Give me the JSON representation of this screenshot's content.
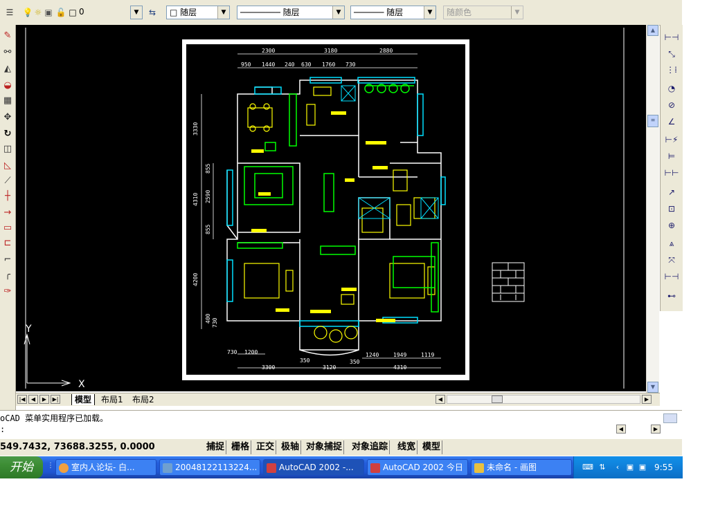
{
  "properties_toolbar": {
    "layer_value": "0",
    "color_value": "随层",
    "linetype_value": "随层",
    "lineweight_value": "随层",
    "plotstyle_value": "随颜色"
  },
  "tabs": {
    "model": "模型",
    "layout1": "布局1",
    "layout2": "布局2"
  },
  "axis": {
    "y": "Y",
    "x": "X"
  },
  "dimensions": {
    "top_row1": [
      "2300",
      "3180",
      "2880"
    ],
    "top_row2": [
      "950",
      "1440",
      "240",
      "630",
      "1760",
      "730"
    ],
    "left": [
      "3330",
      "855",
      "2590",
      "855",
      "4310",
      "4200",
      "400",
      "730"
    ],
    "bottom_row1": [
      "730",
      "1200",
      "350",
      "350",
      "1240",
      "1949",
      "1119"
    ],
    "bottom_row2": [
      "3300",
      "3120",
      "4310"
    ]
  },
  "command": {
    "line1": "oCAD 菜单实用程序已加载。",
    "line2": ":"
  },
  "status": {
    "coords": "549.7432, 73688.3255, 0.0000",
    "buttons": [
      "捕捉",
      "栅格",
      "正交",
      "极轴",
      "对象捕捉",
      "对象追踪",
      "线宽",
      "模型"
    ]
  },
  "taskbar": {
    "start": "开始",
    "items": [
      {
        "label": "室内人论坛- 白...",
        "icon_color": "#f0a040"
      },
      {
        "label": "20048122113224...",
        "icon_color": "#6fa0d0"
      },
      {
        "label": "AutoCAD 2002 -...",
        "icon_color": "#d04040"
      },
      {
        "label": "AutoCAD 2002 今日",
        "icon_color": "#d04040"
      },
      {
        "label": "未命名 - 画图",
        "icon_color": "#e8c040"
      }
    ],
    "clock": "9:55"
  }
}
